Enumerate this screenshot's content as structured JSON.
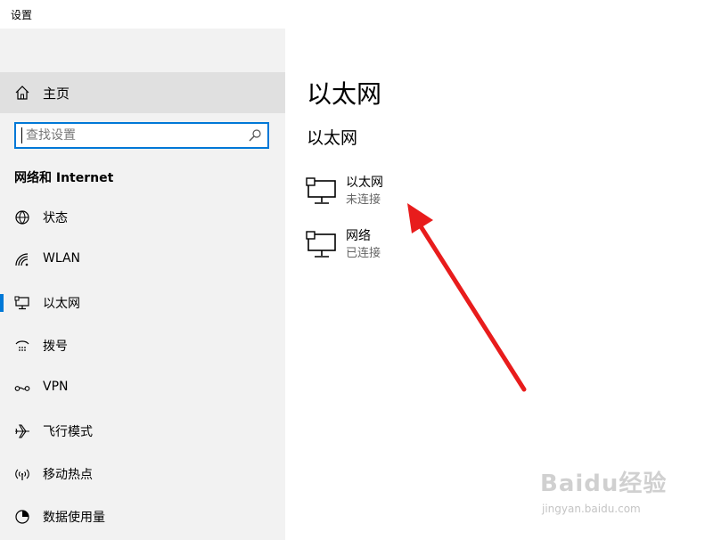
{
  "window": {
    "title": "设置"
  },
  "sidebar": {
    "home_label": "主页",
    "search_placeholder": "查找设置",
    "section_title": "网络和 Internet",
    "items": [
      {
        "label": "状态",
        "icon": "globe-icon"
      },
      {
        "label": "WLAN",
        "icon": "wifi-icon"
      },
      {
        "label": "以太网",
        "icon": "ethernet-icon",
        "selected": true
      },
      {
        "label": "拨号",
        "icon": "dialup-icon"
      },
      {
        "label": "VPN",
        "icon": "vpn-icon"
      },
      {
        "label": "飞行模式",
        "icon": "airplane-icon"
      },
      {
        "label": "移动热点",
        "icon": "hotspot-icon"
      },
      {
        "label": "数据使用量",
        "icon": "data-usage-icon"
      }
    ]
  },
  "content": {
    "page_title": "以太网",
    "sub_title": "以太网",
    "adapters": [
      {
        "name": "以太网",
        "status": "未连接",
        "icon": "network-adapter-icon"
      },
      {
        "name": "网络",
        "status": "已连接",
        "icon": "network-adapter-icon"
      }
    ]
  },
  "watermark": {
    "brand": "Baidu经验",
    "url": "jingyan.baidu.com"
  },
  "colors": {
    "accent": "#0078d7",
    "sidebar_bg": "#f2f2f2",
    "home_bg": "#e0e0e0",
    "arrow": "#e81c1c"
  }
}
